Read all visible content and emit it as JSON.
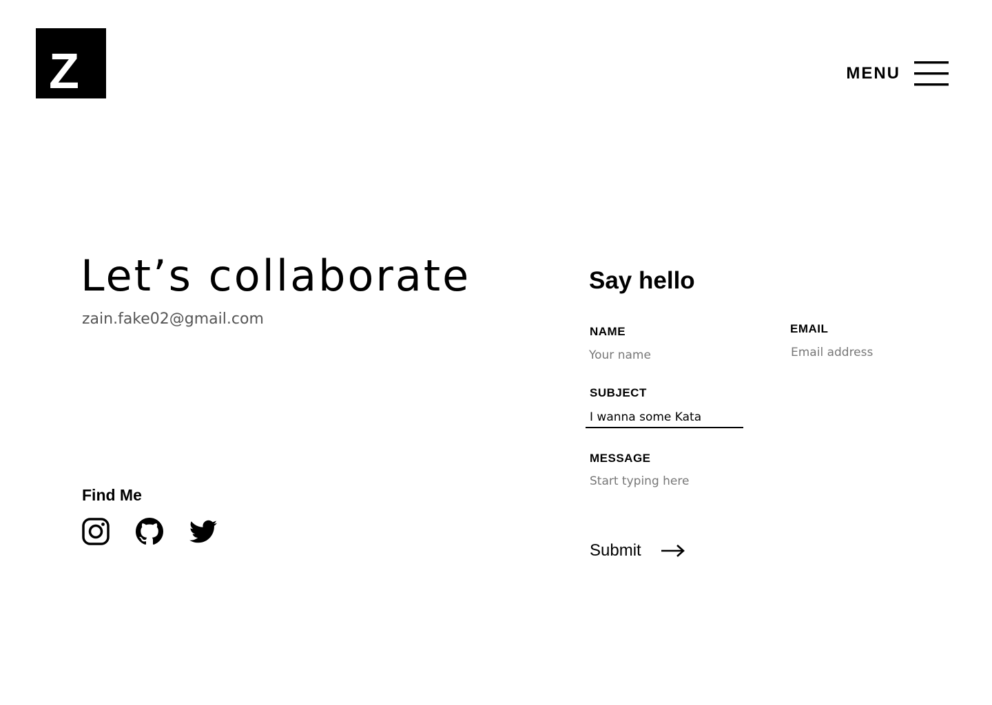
{
  "brand": {
    "logo_letter": "Z"
  },
  "header": {
    "menu_label": "MENU",
    "menu_icon": "hamburger-icon"
  },
  "intro": {
    "headline": "Let’s collaborate",
    "email": "zain.fake02@gmail.com"
  },
  "social": {
    "heading": "Find Me",
    "links": [
      {
        "icon": "instagram-icon"
      },
      {
        "icon": "github-icon"
      },
      {
        "icon": "twitter-icon"
      }
    ]
  },
  "form": {
    "title": "Say hello",
    "name": {
      "label": "NAME",
      "placeholder": "Your name",
      "value": ""
    },
    "email": {
      "label": "EMAIL",
      "placeholder": "Email address",
      "value": ""
    },
    "subject": {
      "label": "SUBJECT",
      "placeholder": "",
      "value": "I wanna some Kata"
    },
    "message": {
      "label": "MESSAGE",
      "placeholder": "Start typing here",
      "value": ""
    },
    "submit_label": "Submit",
    "submit_icon": "arrow-right-icon"
  },
  "colors": {
    "text": "#000000",
    "muted_text": "#555555",
    "placeholder": "#777777",
    "background": "#ffffff",
    "logo_bg": "#000000"
  }
}
